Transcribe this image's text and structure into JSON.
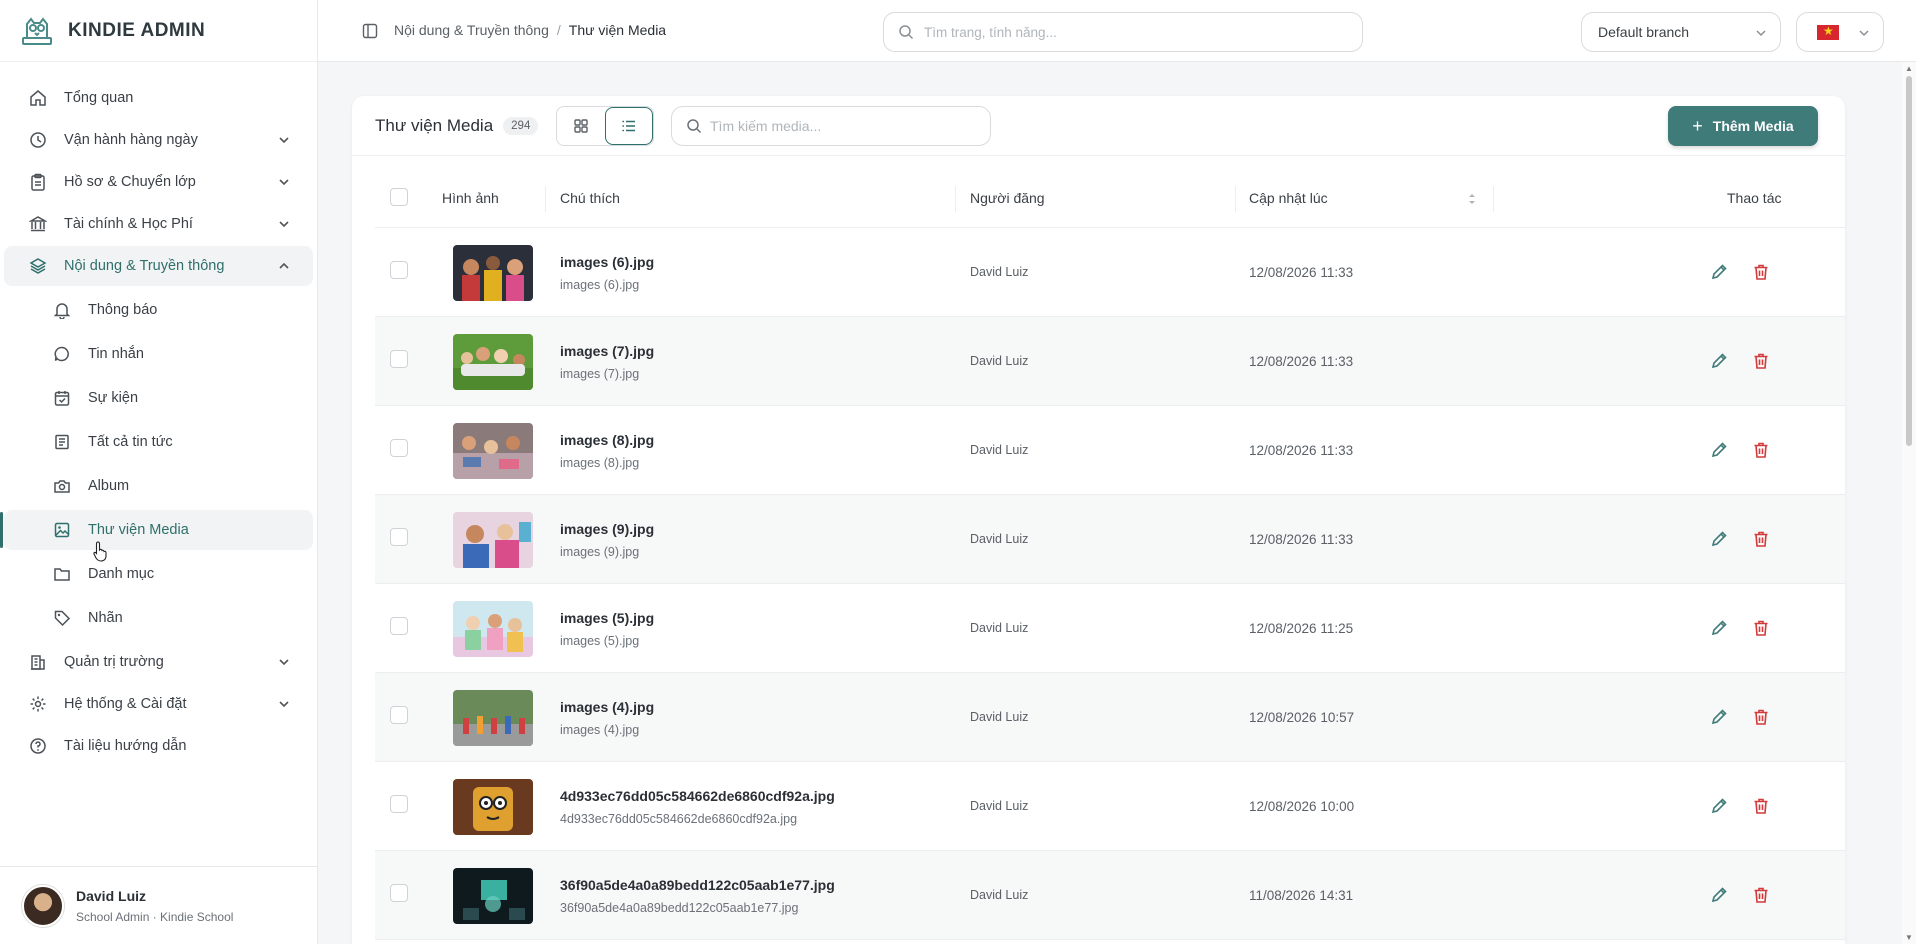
{
  "app": {
    "brand": "KINDIE ADMIN"
  },
  "sidebar": {
    "items": [
      {
        "label": "Tổng quan",
        "icon": "home-icon"
      },
      {
        "label": "Vận hành hàng ngày",
        "icon": "clock-icon"
      },
      {
        "label": "Hồ sơ & Chuyển lớp",
        "icon": "clipboard-icon"
      },
      {
        "label": "Tài chính & Học Phí",
        "icon": "bank-icon"
      },
      {
        "label": "Nội dung & Truyền thông",
        "icon": "layers-icon"
      }
    ],
    "sub_items": [
      {
        "label": "Thông báo",
        "icon": "bell-icon"
      },
      {
        "label": "Tin nhắn",
        "icon": "message-icon"
      },
      {
        "label": "Sự kiện",
        "icon": "calendar-check-icon"
      },
      {
        "label": "Tất cả tin tức",
        "icon": "newspaper-icon"
      },
      {
        "label": "Album",
        "icon": "camera-icon"
      },
      {
        "label": "Thư viện Media",
        "icon": "image-icon"
      },
      {
        "label": "Danh mục",
        "icon": "folder-icon"
      },
      {
        "label": "Nhãn",
        "icon": "tag-icon"
      }
    ],
    "bottom_items": [
      {
        "label": "Quản trị trường",
        "icon": "building-icon"
      },
      {
        "label": "Hệ thống & Cài đặt",
        "icon": "gear-icon"
      },
      {
        "label": "Tài liệu hướng dẫn",
        "icon": "help-circle-icon"
      }
    ],
    "user": {
      "name": "David Luiz",
      "role": "School Admin · Kindie School"
    }
  },
  "header": {
    "breadcrumb": [
      "Nội dung & Truyền thông",
      "Thư viện Media"
    ],
    "breadcrumb_sep": "/",
    "search_placeholder": "Tìm trang, tính năng...",
    "branch": "Default branch",
    "language_flag": "vietnam-flag"
  },
  "media": {
    "title": "Thư viện Media",
    "count": "294",
    "search_placeholder": "Tìm kiếm media...",
    "add_label": "Thêm Media",
    "add_plus": "+",
    "columns": {
      "image": "Hình ảnh",
      "caption": "Chú thích",
      "poster": "Người đăng",
      "updated": "Cập nhật lúc",
      "actions": "Thao tác"
    },
    "rows": [
      {
        "title": "images (6).jpg",
        "file": "images (6).jpg",
        "poster": "David Luiz",
        "updated": "12/08/2026 11:33"
      },
      {
        "title": "images (7).jpg",
        "file": "images (7).jpg",
        "poster": "David Luiz",
        "updated": "12/08/2026 11:33"
      },
      {
        "title": "images (8).jpg",
        "file": "images (8).jpg",
        "poster": "David Luiz",
        "updated": "12/08/2026 11:33"
      },
      {
        "title": "images (9).jpg",
        "file": "images (9).jpg",
        "poster": "David Luiz",
        "updated": "12/08/2026 11:33"
      },
      {
        "title": "images (5).jpg",
        "file": "images (5).jpg",
        "poster": "David Luiz",
        "updated": "12/08/2026 11:25"
      },
      {
        "title": "images (4).jpg",
        "file": "images (4).jpg",
        "poster": "David Luiz",
        "updated": "12/08/2026 10:57"
      },
      {
        "title": "4d933ec76dd05c584662de6860cdf92a.jpg",
        "file": "4d933ec76dd05c584662de6860cdf92a.jpg",
        "poster": "David Luiz",
        "updated": "12/08/2026 10:00"
      },
      {
        "title": "36f90a5de4a0a89bedd122c05aab1e77.jpg",
        "file": "36f90a5de4a0a89bedd122c05aab1e77.jpg",
        "poster": "David Luiz",
        "updated": "11/08/2026 14:31"
      }
    ]
  },
  "colors": {
    "accent": "#3f7b79",
    "danger": "#d33a3a"
  }
}
